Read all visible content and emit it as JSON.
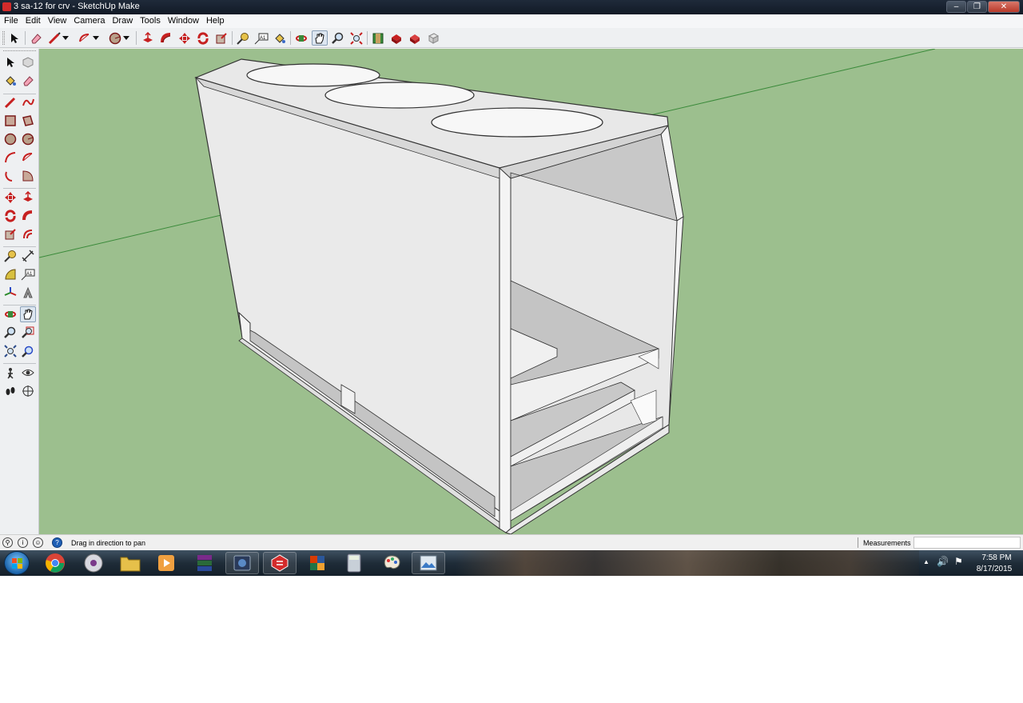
{
  "window": {
    "title": "3 sa-12 for crv - SketchUp Make",
    "minimize_glyph": "‒",
    "maximize_glyph": "❐",
    "close_glyph": "✕"
  },
  "menu": [
    "File",
    "Edit",
    "View",
    "Camera",
    "Draw",
    "Tools",
    "Window",
    "Help"
  ],
  "toolbar": {
    "icons": [
      "select-icon",
      "eraser-icon",
      "line-icon",
      "arc-icon",
      "circle-icon",
      "push-pull-icon",
      "follow-me-icon",
      "move-icon",
      "rotate-icon",
      "scale-icon",
      "tape-measure-icon",
      "text-icon",
      "paint-bucket-icon",
      "orbit-icon",
      "pan-icon",
      "zoom-icon",
      "zoom-extents-icon",
      "3d-warehouse-icon",
      "share-model-icon",
      "extension-warehouse-icon",
      "layout-icon"
    ],
    "active": "pan-icon"
  },
  "left_toolbar": {
    "active": "pan-icon"
  },
  "colors": {
    "viewport_background": "#9cbf8e",
    "model_face": "#eaeaea",
    "model_shadow_face": "#c4c4c4",
    "red_axis": "#3a8a3a"
  },
  "status": {
    "hint": "Drag in direction to pan",
    "measurements_label": "Measurements",
    "measurements_value": ""
  },
  "taskbar": {
    "apps": [
      "chrome-icon",
      "media-player-icon",
      "explorer-icon",
      "media-center-icon",
      "winrar-icon",
      "screen-capture-icon",
      "sketchup-icon",
      "office-icon",
      "calculator-icon",
      "paint-icon",
      "image-viewer-icon"
    ],
    "time": "7:58 PM",
    "date": "8/17/2015"
  }
}
